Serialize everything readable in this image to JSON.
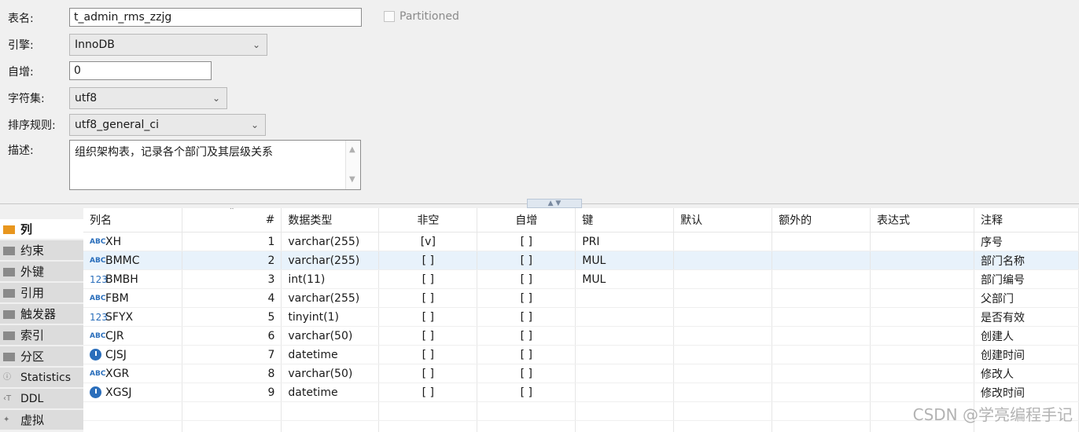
{
  "form": {
    "table_name_label": "表名:",
    "table_name_value": "t_admin_rms_zzjg",
    "partitioned_label": "Partitioned",
    "engine_label": "引擎:",
    "engine_value": "InnoDB",
    "auto_inc_label": "自增:",
    "auto_inc_value": "0",
    "charset_label": "字符集:",
    "charset_value": "utf8",
    "collation_label": "排序规则:",
    "collation_value": "utf8_general_ci",
    "description_label": "描述:",
    "description_value": "组织架构表，记录各个部门及其层级关系"
  },
  "tabs": [
    {
      "label": "列",
      "icon": "folder-icon",
      "active": true
    },
    {
      "label": "约束",
      "icon": "constraint-icon"
    },
    {
      "label": "外键",
      "icon": "folder-icon"
    },
    {
      "label": "引用",
      "icon": "folder-icon"
    },
    {
      "label": "触发器",
      "icon": "folder-icon"
    },
    {
      "label": "索引",
      "icon": "folder-icon"
    },
    {
      "label": "分区",
      "icon": "folder-icon"
    },
    {
      "label": "Statistics",
      "icon": "info-icon"
    },
    {
      "label": "DDL",
      "icon": "ddl-icon"
    },
    {
      "label": "虚拟",
      "icon": "virtual-icon"
    }
  ],
  "grid": {
    "headers": [
      "列名",
      "#",
      "数据类型",
      "非空",
      "自增",
      "键",
      "默认",
      "额外的",
      "表达式",
      "注释"
    ],
    "rows": [
      {
        "icon": "ABC",
        "name": "XH",
        "num": "1",
        "type": "varchar(255)",
        "notnull": "[v]",
        "autoinc": "[ ]",
        "key": "PRI",
        "comment": "序号"
      },
      {
        "icon": "ABC",
        "name": "BMMC",
        "num": "2",
        "type": "varchar(255)",
        "notnull": "[ ]",
        "autoinc": "[ ]",
        "key": "MUL",
        "comment": "部门名称"
      },
      {
        "icon": "123",
        "name": "BMBH",
        "num": "3",
        "type": "int(11)",
        "notnull": "[ ]",
        "autoinc": "[ ]",
        "key": "MUL",
        "comment": "部门编号"
      },
      {
        "icon": "ABC",
        "name": "FBM",
        "num": "4",
        "type": "varchar(255)",
        "notnull": "[ ]",
        "autoinc": "[ ]",
        "key": "",
        "comment": "父部门"
      },
      {
        "icon": "123",
        "name": "SFYX",
        "num": "5",
        "type": "tinyint(1)",
        "notnull": "[ ]",
        "autoinc": "[ ]",
        "key": "",
        "comment": "是否有效"
      },
      {
        "icon": "ABC",
        "name": "CJR",
        "num": "6",
        "type": "varchar(50)",
        "notnull": "[ ]",
        "autoinc": "[ ]",
        "key": "",
        "comment": "创建人"
      },
      {
        "icon": "clock",
        "name": "CJSJ",
        "num": "7",
        "type": "datetime",
        "notnull": "[ ]",
        "autoinc": "[ ]",
        "key": "",
        "comment": "创建时间"
      },
      {
        "icon": "ABC",
        "name": "XGR",
        "num": "8",
        "type": "varchar(50)",
        "notnull": "[ ]",
        "autoinc": "[ ]",
        "key": "",
        "comment": "修改人"
      },
      {
        "icon": "clock",
        "name": "XGSJ",
        "num": "9",
        "type": "datetime",
        "notnull": "[ ]",
        "autoinc": "[ ]",
        "key": "",
        "comment": "修改时间"
      }
    ],
    "selected_row": 1
  },
  "watermark": "CSDN @学亮编程手记"
}
